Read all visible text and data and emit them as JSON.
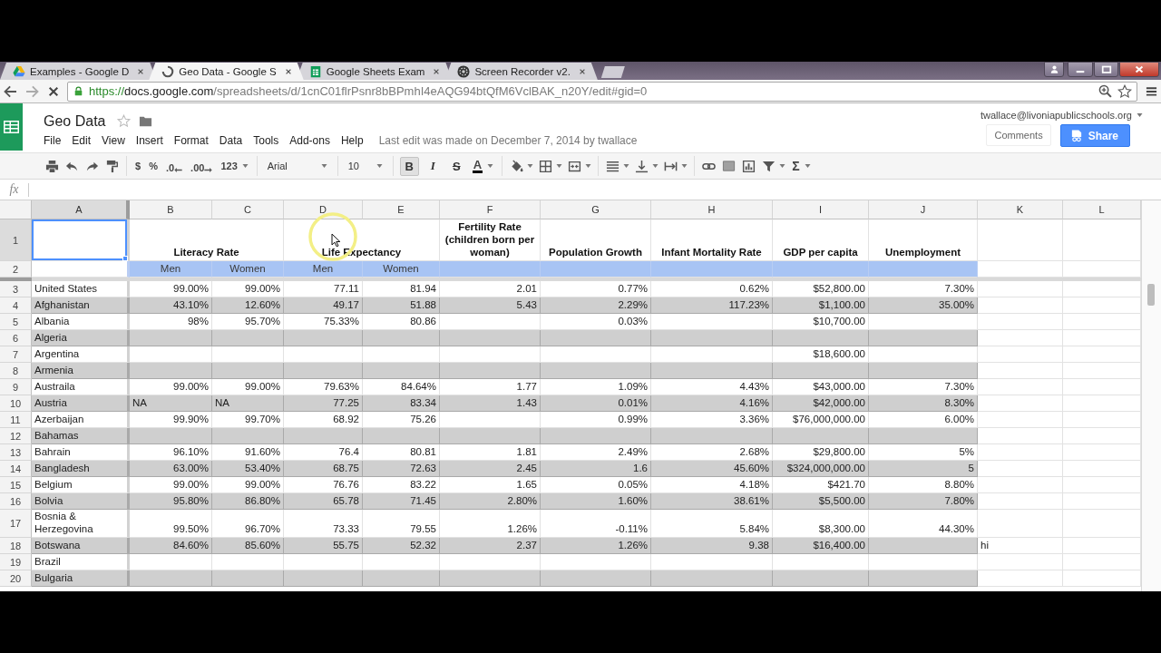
{
  "browser": {
    "tabs": [
      {
        "title": "Examples - Google D",
        "kind": "drive",
        "selected": false
      },
      {
        "title": "Geo Data - Google S",
        "kind": "loading",
        "selected": true
      },
      {
        "title": "Google Sheets Exam",
        "kind": "sheets",
        "selected": false
      },
      {
        "title": "Screen Recorder v2.",
        "kind": "recorder",
        "selected": false
      }
    ],
    "address": {
      "scheme": "https://",
      "host": "docs.google.com",
      "path": "/spreadsheets/d/1cnC01flrPsnr8bBPmhI4eAQG94btQfM6VclBAK_n20Y/edit#gid=0"
    }
  },
  "document": {
    "title": "Geo Data",
    "menu": [
      "File",
      "Edit",
      "View",
      "Insert",
      "Format",
      "Data",
      "Tools",
      "Add-ons",
      "Help"
    ],
    "last_edit": "Last edit was made on December 7, 2014 by twallace",
    "account": "twallace@livoniapublicschools.org",
    "comments_button": "Comments",
    "share_button": "Share"
  },
  "toolbar": {
    "currency": "$",
    "percent": "%",
    "decrease_decimals": ".0",
    "increase_decimals": ".00",
    "number_format": "123",
    "font": "Arial",
    "font_size": "10",
    "styles": [
      {
        "label": "B",
        "kind": "bold",
        "on": true
      },
      {
        "label": "I",
        "kind": "italic",
        "on": false
      },
      {
        "label": "S",
        "kind": "strike",
        "on": false
      }
    ],
    "text_color": "A",
    "functions": "Σ"
  },
  "formula_bar": {
    "label": "fx"
  },
  "sheet": {
    "columns": [
      {
        "label": "A",
        "selected": true
      },
      {
        "label": "B",
        "selected": false
      },
      {
        "label": "C",
        "selected": false
      },
      {
        "label": "D",
        "selected": false
      },
      {
        "label": "E",
        "selected": false
      },
      {
        "label": "F",
        "selected": false
      },
      {
        "label": "G",
        "selected": false
      },
      {
        "label": "H",
        "selected": false
      },
      {
        "label": "I",
        "selected": false
      },
      {
        "label": "J",
        "selected": false
      },
      {
        "label": "K",
        "selected": false
      },
      {
        "label": "L",
        "selected": false
      }
    ],
    "rows": [
      {
        "number": "1",
        "kind": "title",
        "selected": true,
        "cells": [
          null,
          {
            "text": "Literacy Rate",
            "merged": true
          },
          null,
          {
            "text": "Life Expectancy",
            "merged": true
          },
          null,
          "Fertility Rate (children born per woman)",
          "Population Growth",
          "Infant Mortality Rate",
          "GDP per capita",
          "Unemployment"
        ]
      },
      {
        "number": "2",
        "kind": "subtitle",
        "selected": false,
        "cells": [
          null,
          "Men",
          "Women",
          "Men",
          "Women"
        ]
      },
      {
        "number": "3",
        "kind": "data",
        "selected": false,
        "shaded": false,
        "cells": [
          "United States",
          "99.00%",
          "99.00%",
          "77.11",
          "81.94",
          "2.01",
          "0.77%",
          "0.62%",
          "$52,800.00",
          "7.30%"
        ]
      },
      {
        "number": "4",
        "kind": "data",
        "selected": false,
        "shaded": true,
        "cells": [
          "Afghanistan",
          "43.10%",
          "12.60%",
          "49.17",
          "51.88",
          "5.43",
          "2.29%",
          "117.23%",
          "$1,100.00",
          "35.00%"
        ]
      },
      {
        "number": "5",
        "kind": "data",
        "selected": false,
        "shaded": false,
        "cells": [
          "Albania",
          "98%",
          "95.70%",
          "75.33%",
          "80.86",
          null,
          "0.03%",
          null,
          "$10,700.00"
        ]
      },
      {
        "number": "6",
        "kind": "data",
        "selected": false,
        "shaded": true,
        "cells": [
          "Algeria"
        ]
      },
      {
        "number": "7",
        "kind": "data",
        "selected": false,
        "shaded": false,
        "cells": [
          "Argentina",
          null,
          null,
          null,
          null,
          null,
          null,
          null,
          "$18,600.00"
        ]
      },
      {
        "number": "8",
        "kind": "data",
        "selected": false,
        "shaded": true,
        "cells": [
          "Armenia"
        ]
      },
      {
        "number": "9",
        "kind": "data",
        "selected": false,
        "shaded": false,
        "cells": [
          "Austraila",
          "99.00%",
          "99.00%",
          "79.63%",
          "84.64%",
          "1.77",
          "1.09%",
          "4.43%",
          "$43,000.00",
          "7.30%"
        ]
      },
      {
        "number": "10",
        "kind": "data",
        "selected": false,
        "shaded": true,
        "cells": [
          "Austria",
          {
            "text": "NA",
            "kind": "text"
          },
          {
            "text": "NA",
            "kind": "text"
          },
          "77.25",
          "83.34",
          "1.43",
          "0.01%",
          "4.16%",
          "$42,000.00",
          "8.30%"
        ]
      },
      {
        "number": "11",
        "kind": "data",
        "selected": false,
        "shaded": false,
        "cells": [
          "Azerbaijan",
          "99.90%",
          "99.70%",
          "68.92",
          "75.26",
          null,
          "0.99%",
          "3.36%",
          "$76,000,000.00",
          "6.00%"
        ]
      },
      {
        "number": "12",
        "kind": "data",
        "selected": false,
        "shaded": true,
        "cells": [
          "Bahamas"
        ]
      },
      {
        "number": "13",
        "kind": "data",
        "selected": false,
        "shaded": false,
        "cells": [
          "Bahrain",
          "96.10%",
          "91.60%",
          "76.4",
          "80.81",
          "1.81",
          "2.49%",
          "2.68%",
          "$29,800.00",
          "5%"
        ]
      },
      {
        "number": "14",
        "kind": "data",
        "selected": false,
        "shaded": true,
        "cells": [
          "Bangladesh",
          "63.00%",
          "53.40%",
          "68.75",
          "72.63",
          "2.45",
          "1.6",
          "45.60%",
          "$324,000,000.00",
          "5"
        ]
      },
      {
        "number": "15",
        "kind": "data",
        "selected": false,
        "shaded": false,
        "cells": [
          "Belgium",
          "99.00%",
          "99.00%",
          "76.76",
          "83.22",
          "1.65",
          "0.05%",
          "4.18%",
          "$421.70",
          "8.80%"
        ]
      },
      {
        "number": "16",
        "kind": "data",
        "selected": false,
        "shaded": true,
        "cells": [
          "Bolvia",
          "95.80%",
          "86.80%",
          "65.78",
          "71.45",
          "2.80%",
          "1.60%",
          "38.61%",
          "$5,500.00",
          "7.80%"
        ]
      },
      {
        "number": "17",
        "kind": "data",
        "selected": false,
        "shaded": false,
        "cells": [
          "Bosnia & Herzegovina",
          "99.50%",
          "96.70%",
          "73.33",
          "79.55",
          "1.26%",
          "-0.11%",
          "5.84%",
          "$8,300.00",
          "44.30%"
        ]
      },
      {
        "number": "18",
        "kind": "data",
        "selected": false,
        "shaded": true,
        "cells": [
          "Botswana",
          "84.60%",
          "85.60%",
          "55.75",
          "52.32",
          "2.37",
          "1.26%",
          "9.38",
          "$16,400.00",
          null,
          {
            "text": "hi",
            "kind": "text"
          }
        ]
      },
      {
        "number": "19",
        "kind": "data",
        "selected": false,
        "shaded": false,
        "cells": [
          "Brazil"
        ]
      },
      {
        "number": "20",
        "kind": "data",
        "selected": false,
        "shaded": true,
        "cells": [
          "Bulgaria"
        ]
      }
    ]
  }
}
